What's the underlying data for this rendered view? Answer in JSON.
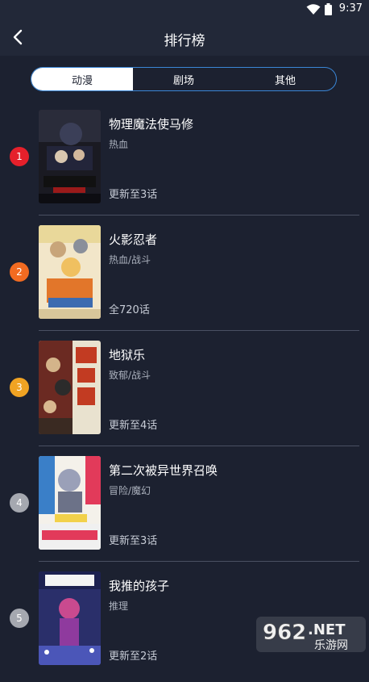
{
  "status_bar": {
    "time": "9:37",
    "wifi_icon": "wifi-icon",
    "battery_icon": "battery-icon"
  },
  "header": {
    "title": "排行榜",
    "back_icon": "chevron-left-icon"
  },
  "tabs": [
    {
      "label": "动漫",
      "active": true
    },
    {
      "label": "剧场",
      "active": false
    },
    {
      "label": "其他",
      "active": false
    }
  ],
  "rankings": [
    {
      "rank": "1",
      "title": "物理魔法使马修",
      "genre": "热血",
      "episodes": "更新至3话",
      "rank_color": "#e5202b"
    },
    {
      "rank": "2",
      "title": "火影忍者",
      "genre": "热血/战斗",
      "episodes": "全720话",
      "rank_color": "#f26b21"
    },
    {
      "rank": "3",
      "title": "地狱乐",
      "genre": "致郁/战斗",
      "episodes": "更新至4话",
      "rank_color": "#f0a323"
    },
    {
      "rank": "4",
      "title": "第二次被异世界召唤",
      "genre": "冒险/魔幻",
      "episodes": "更新至3话",
      "rank_color": "#a5a8b0"
    },
    {
      "rank": "5",
      "title": "我推的孩子",
      "genre": "推理",
      "episodes": "更新至2话",
      "rank_color": "#a5a8b0"
    }
  ],
  "watermark": {
    "number": "962",
    "suffix": ".NET",
    "tagline": "乐游网"
  },
  "colors": {
    "background": "#1c2130",
    "header": "#222838",
    "tab_border": "#3a86d6"
  }
}
